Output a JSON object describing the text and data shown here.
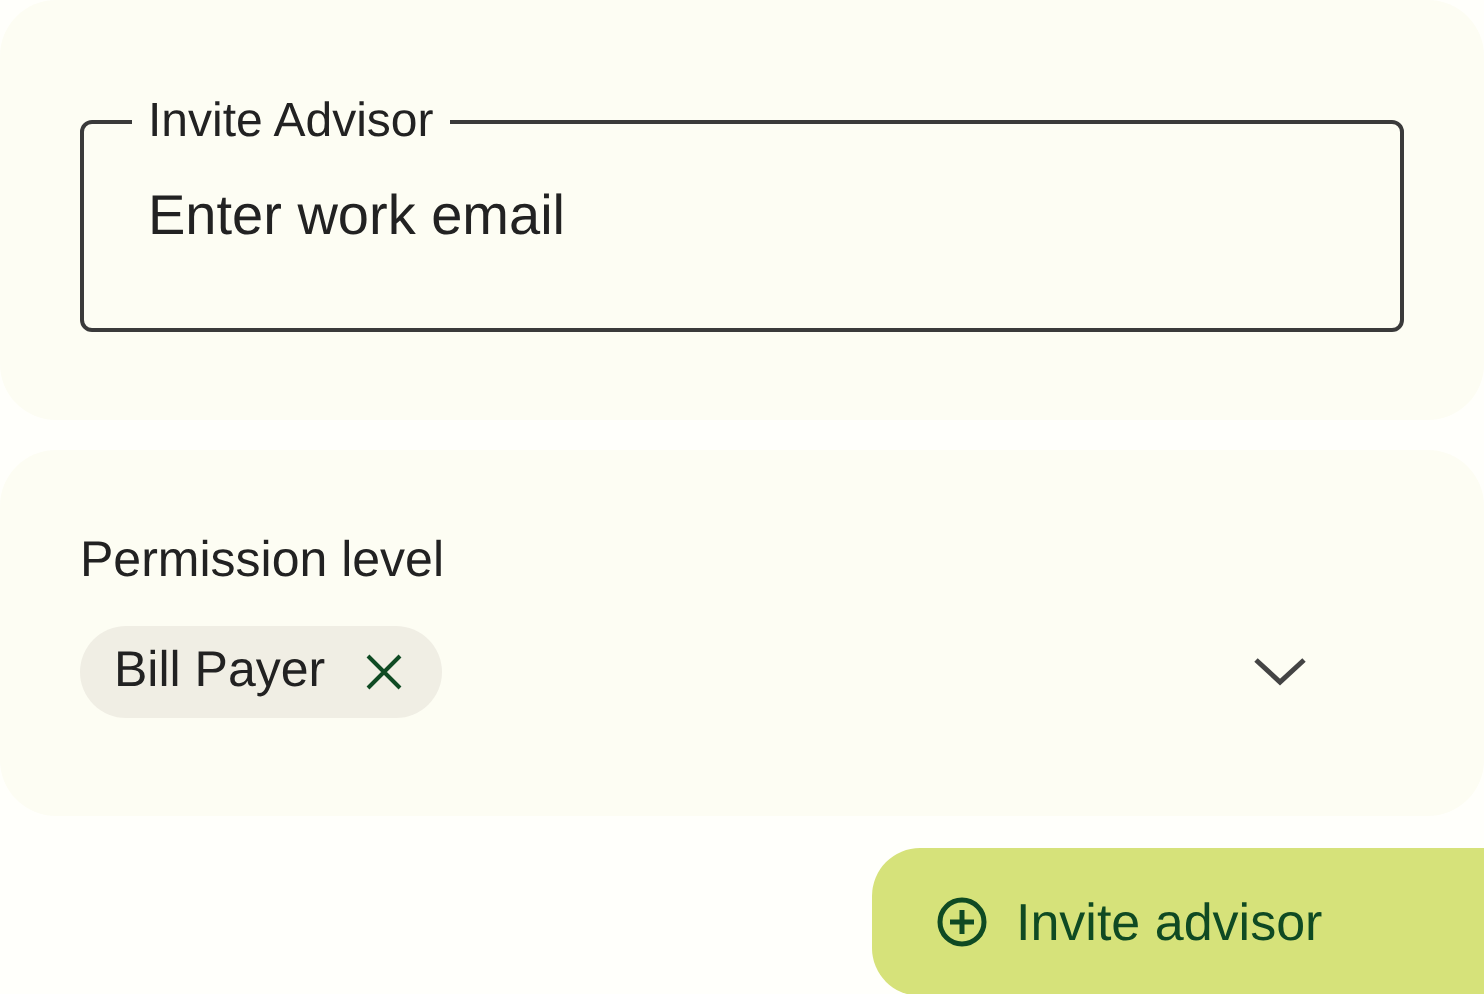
{
  "invite_field": {
    "label": "Invite Advisor",
    "placeholder": "Enter work email"
  },
  "permission": {
    "label": "Permission level",
    "chips": [
      {
        "label": "Bill Payer",
        "removable": true
      }
    ]
  },
  "submit_button": {
    "label": "Invite advisor"
  }
}
